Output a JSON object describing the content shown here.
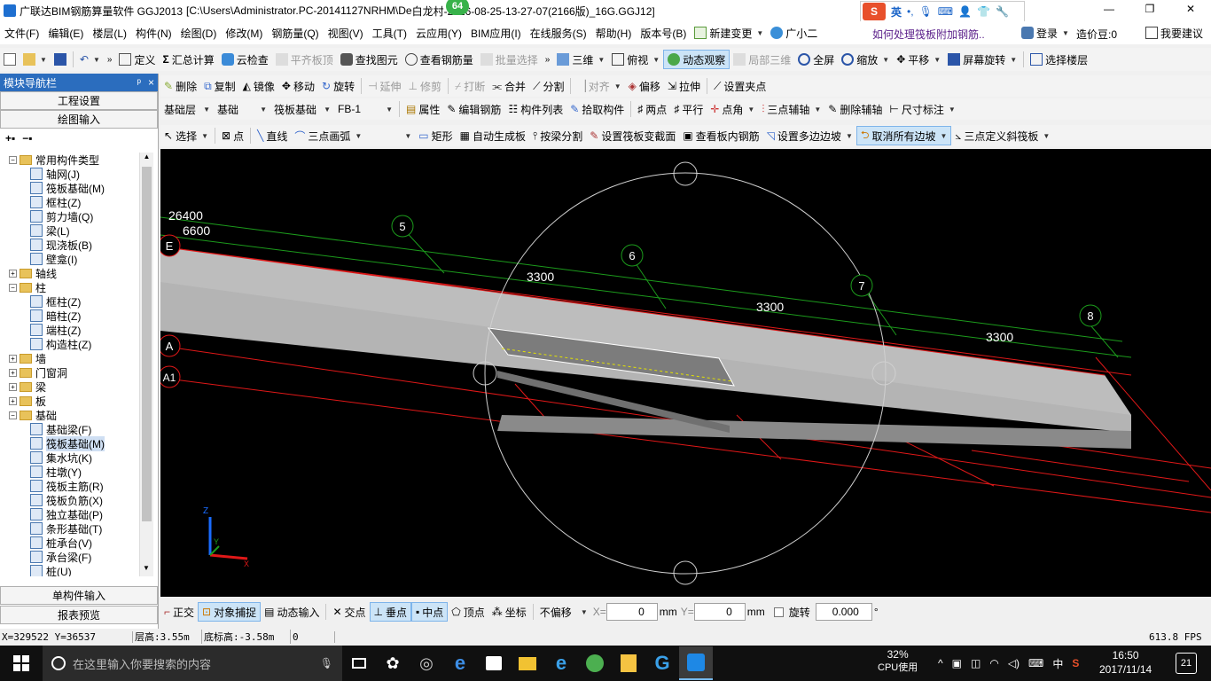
{
  "titlebar": {
    "app_name": "广联达BIM钢筋算量软件 GGJ2013",
    "path_a": "[C:\\Users\\Administrator.PC-20141127NRHM\\De",
    "path_b": "白龙村-2016-08-25-13-27-07(2166版)_16G.GGJ12]",
    "badge": "64",
    "ime_lang": "英",
    "min": "—",
    "max": "❐",
    "close": "✕"
  },
  "menu": {
    "items": [
      "文件(F)",
      "编辑(E)",
      "楼层(L)",
      "构件(N)",
      "绘图(D)",
      "修改(M)",
      "钢筋量(Q)",
      "视图(V)",
      "工具(T)",
      "云应用(Y)",
      "BIM应用(I)",
      "在线服务(S)",
      "帮助(H)",
      "版本号(B)"
    ],
    "new_change": "新建变更",
    "assistant": "广小二",
    "hint": "如何处理筏板附加钢筋..",
    "login": "登录",
    "beans": "造价豆:0",
    "feedback": "我要建议"
  },
  "toolbar1": {
    "define": "定义",
    "sum": "汇总计算",
    "cloud": "云检查",
    "level_top": "平齐板顶",
    "find": "查找图元",
    "view_rebar": "查看钢筋量",
    "batch": "批量选择",
    "threed": "三维",
    "plan": "俯视",
    "dynamic": "动态观察",
    "local3d": "局部三维",
    "fullscreen": "全屏",
    "zoom": "缩放",
    "pan": "平移",
    "rotate_screen": "屏幕旋转",
    "select_floor": "选择楼层"
  },
  "panel": {
    "title": "模块导航栏",
    "pin": "ᵖ",
    "close": "×",
    "btn_project": "工程设置",
    "btn_draw": "绘图输入",
    "btn_single": "单构件输入",
    "btn_report": "报表预览"
  },
  "tree": [
    {
      "level": 0,
      "tgl": "−",
      "folder": true,
      "label": "常用构件类型"
    },
    {
      "level": 1,
      "label": "轴网(J)"
    },
    {
      "level": 1,
      "label": "筏板基础(M)"
    },
    {
      "level": 1,
      "label": "框柱(Z)"
    },
    {
      "level": 1,
      "label": "剪力墙(Q)"
    },
    {
      "level": 1,
      "label": "梁(L)"
    },
    {
      "level": 1,
      "label": "现浇板(B)"
    },
    {
      "level": 1,
      "label": "壁龛(I)"
    },
    {
      "level": 0,
      "tgl": "+",
      "folder": true,
      "label": "轴线"
    },
    {
      "level": 0,
      "tgl": "−",
      "folder": true,
      "label": "柱"
    },
    {
      "level": 1,
      "label": "框柱(Z)"
    },
    {
      "level": 1,
      "label": "暗柱(Z)"
    },
    {
      "level": 1,
      "label": "端柱(Z)"
    },
    {
      "level": 1,
      "label": "构造柱(Z)"
    },
    {
      "level": 0,
      "tgl": "+",
      "folder": true,
      "label": "墙"
    },
    {
      "level": 0,
      "tgl": "+",
      "folder": true,
      "label": "门窗洞"
    },
    {
      "level": 0,
      "tgl": "+",
      "folder": true,
      "label": "梁"
    },
    {
      "level": 0,
      "tgl": "+",
      "folder": true,
      "label": "板"
    },
    {
      "level": 0,
      "tgl": "−",
      "folder": true,
      "label": "基础"
    },
    {
      "level": 1,
      "label": "基础梁(F)"
    },
    {
      "level": 1,
      "label": "筏板基础(M)",
      "selected": true
    },
    {
      "level": 1,
      "label": "集水坑(K)"
    },
    {
      "level": 1,
      "label": "柱墩(Y)"
    },
    {
      "level": 1,
      "label": "筏板主筋(R)"
    },
    {
      "level": 1,
      "label": "筏板负筋(X)"
    },
    {
      "level": 1,
      "label": "独立基础(P)"
    },
    {
      "level": 1,
      "label": "条形基础(T)"
    },
    {
      "level": 1,
      "label": "桩承台(V)"
    },
    {
      "level": 1,
      "label": "承台梁(F)"
    },
    {
      "level": 1,
      "label": "桩(U)"
    }
  ],
  "toolbar2": {
    "delete": "删除",
    "copy": "复制",
    "mirror": "镜像",
    "move": "移动",
    "rotate": "旋转",
    "extend": "延伸",
    "trim": "修剪",
    "break": "打断",
    "merge": "合并",
    "split": "分割",
    "align": "对齐",
    "offset": "偏移",
    "stretch": "拉伸",
    "set_grip": "设置夹点"
  },
  "toolbar3": {
    "floor": "基础层",
    "category": "基础",
    "type": "筏板基础",
    "name": "FB-1",
    "attr": "属性",
    "edit_rebar": "编辑钢筋",
    "list": "构件列表",
    "pick": "拾取构件",
    "two_point": "两点",
    "parallel": "平行",
    "point_angle": "点角",
    "three_point_axis": "三点辅轴",
    "delete_axis": "删除辅轴",
    "dimension": "尺寸标注"
  },
  "toolbar4": {
    "select": "选择",
    "point": "点",
    "line": "直线",
    "arc": "三点画弧",
    "rect": "矩形",
    "auto": "自动生成板",
    "split_beam": "按梁分割",
    "set_section": "设置筏板变截面",
    "view_rebar": "查看板内钢筋",
    "set_slope": "设置多边边坡",
    "cancel_slope": "取消所有边坡",
    "three_point_slope": "三点定义斜筏板"
  },
  "canvas": {
    "labels": {
      "d1": "26400",
      "d2": "6600",
      "e": "E",
      "a": "A",
      "a1": "A1",
      "ax5": "5",
      "ax6": "6",
      "ax7": "7",
      "ax8": "8",
      "s1": "3300",
      "s2": "3300",
      "s3": "3300"
    },
    "axis_z": "Z",
    "axis_x": "X",
    "axis_y": "Y"
  },
  "snapbar": {
    "ortho": "正交",
    "snap": "对象捕捉",
    "dyn": "动态输入",
    "intersect": "交点",
    "perp": "垂点",
    "mid": "中点",
    "vertex": "顶点",
    "coord": "坐标",
    "offset_mode": "不偏移",
    "x_label": "X=",
    "x_val": "0",
    "y_label": "Y=",
    "y_val": "0",
    "unit": "mm",
    "rotate_label": "旋转",
    "rotate_val": "0.000",
    "deg": "°"
  },
  "status": {
    "coords": "X=329522 Y=36537",
    "floor_h": "层高:3.55m",
    "base_h": "底标高:-3.58m",
    "zero": "0",
    "fps": "613.8 FPS"
  },
  "taskbar": {
    "search": "在这里输入你要搜索的内容",
    "cpu_pct": "32%",
    "cpu_label": "CPU使用",
    "ime": "中",
    "time": "16:50",
    "date": "2017/11/14",
    "notif": "21"
  }
}
